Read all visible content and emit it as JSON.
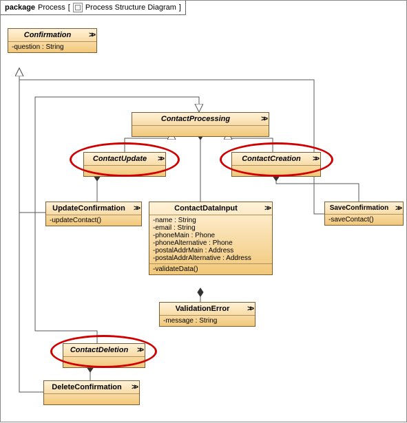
{
  "package": {
    "keyword": "package",
    "name": "Process",
    "bracket_open": "[",
    "bracket_close": "]",
    "diagram_label": "Process Structure Diagram"
  },
  "classes": {
    "confirmation": {
      "name": "Confirmation",
      "attrs": "-question : String"
    },
    "contactProcessing": {
      "name": "ContactProcessing"
    },
    "contactUpdate": {
      "name": "ContactUpdate"
    },
    "contactCreation": {
      "name": "ContactCreation"
    },
    "updateConfirmation": {
      "name": "UpdateConfirmation",
      "ops": "-updateContact()"
    },
    "saveConfirmation": {
      "name": "SaveConfirmation",
      "ops": "-saveContact()"
    },
    "contactDataInput": {
      "name": "ContactDataInput",
      "attrs": "-name : String\n-email : String\n-phoneMain : Phone\n-phoneAlternative : Phone\n-postalAddrMain : Address\n-postalAddrAlternative : Address",
      "ops": "-validateData()"
    },
    "validationError": {
      "name": "ValidationError",
      "attrs": "-message : String"
    },
    "contactDeletion": {
      "name": "ContactDeletion"
    },
    "deleteConfirmation": {
      "name": "DeleteConfirmation"
    }
  },
  "circled": [
    "contactUpdate",
    "contactCreation",
    "contactDeletion"
  ]
}
